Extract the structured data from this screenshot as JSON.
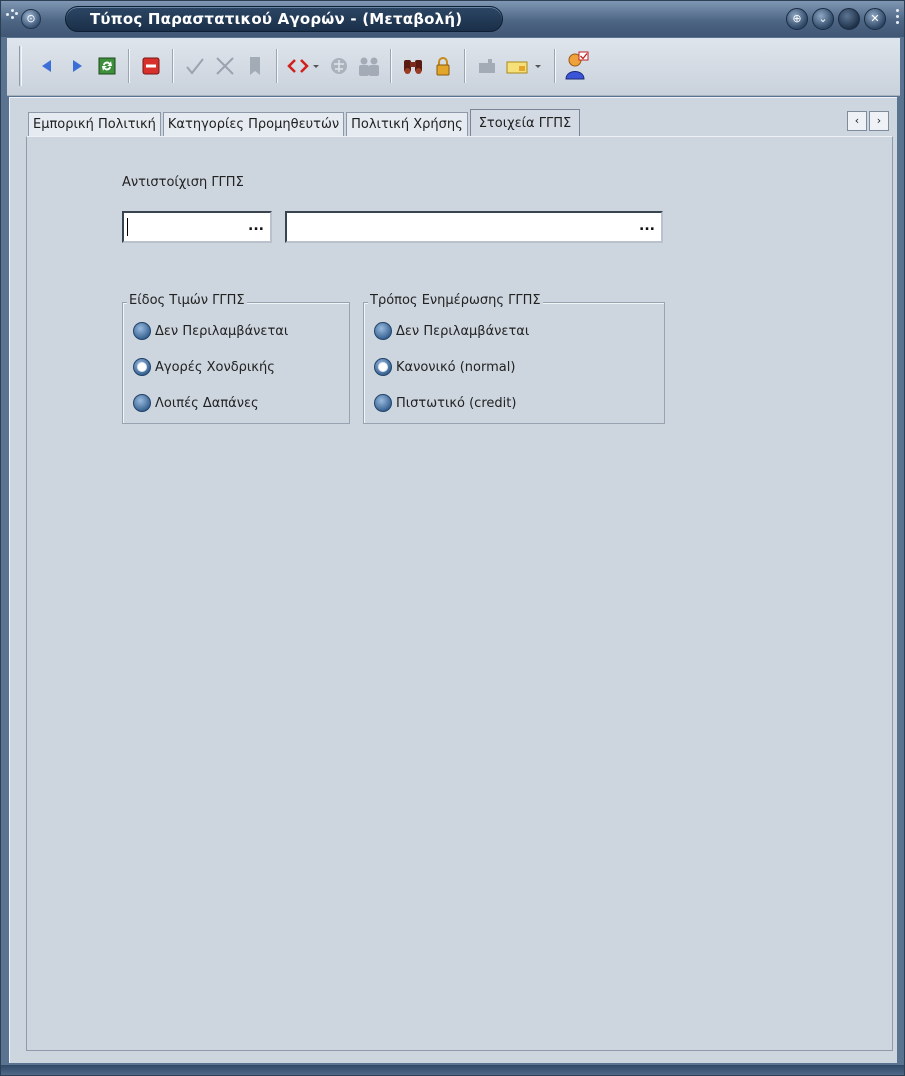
{
  "window": {
    "title": "Τύπος Παραστατικού Αγορών - (Μεταβολή)"
  },
  "toolbar": {
    "buttons": [
      {
        "name": "previous",
        "icon": "arrow-left-icon"
      },
      {
        "name": "next",
        "icon": "arrow-right-icon"
      },
      {
        "name": "refresh",
        "icon": "refresh-icon"
      },
      {
        "name": "delete",
        "icon": "stop-icon"
      },
      {
        "name": "confirm",
        "icon": "check-icon"
      },
      {
        "name": "cancel",
        "icon": "x-icon"
      },
      {
        "name": "bookmark",
        "icon": "bookmark-icon"
      },
      {
        "name": "code",
        "icon": "code-brackets-icon"
      },
      {
        "name": "globe",
        "icon": "globe-icon"
      },
      {
        "name": "users",
        "icon": "users-icon"
      },
      {
        "name": "find",
        "icon": "binoculars-icon"
      },
      {
        "name": "lock",
        "icon": "lock-icon"
      },
      {
        "name": "mailbox",
        "icon": "mailbox-icon"
      },
      {
        "name": "folder",
        "icon": "folder-icon"
      },
      {
        "name": "user-settings",
        "icon": "user-settings-icon"
      }
    ]
  },
  "tabs": [
    {
      "label": "Εμπορική Πολιτική",
      "active": false
    },
    {
      "label": "Κατηγορίες Προμηθευτών",
      "active": false
    },
    {
      "label": "Πολιτική Χρήσης",
      "active": false
    },
    {
      "label": "Στοιχεία ΓΓΠΣ",
      "active": true
    }
  ],
  "tab_scroll": {
    "left": "‹",
    "right": "›"
  },
  "form": {
    "mapping_label": "Αντιστοίχιση ΓΓΠΣ",
    "field1": {
      "value": "",
      "button": "..."
    },
    "field2": {
      "value": "",
      "button": "..."
    },
    "price_group": {
      "title": "Είδος Τιμών ΓΓΠΣ",
      "options": [
        {
          "label": "Δεν Περιλαμβάνεται",
          "checked": false
        },
        {
          "label": "Αγορές Χονδρικής",
          "checked": true
        },
        {
          "label": "Λοιπές Δαπάνες",
          "checked": false
        }
      ]
    },
    "update_group": {
      "title": "Τρόπος Ενημέρωσης ΓΓΠΣ",
      "options": [
        {
          "label": "Δεν Περιλαμβάνεται",
          "checked": false
        },
        {
          "label": "Κανονικό (normal)",
          "checked": true
        },
        {
          "label": "Πιστωτικό (credit)",
          "checked": false
        }
      ]
    }
  }
}
